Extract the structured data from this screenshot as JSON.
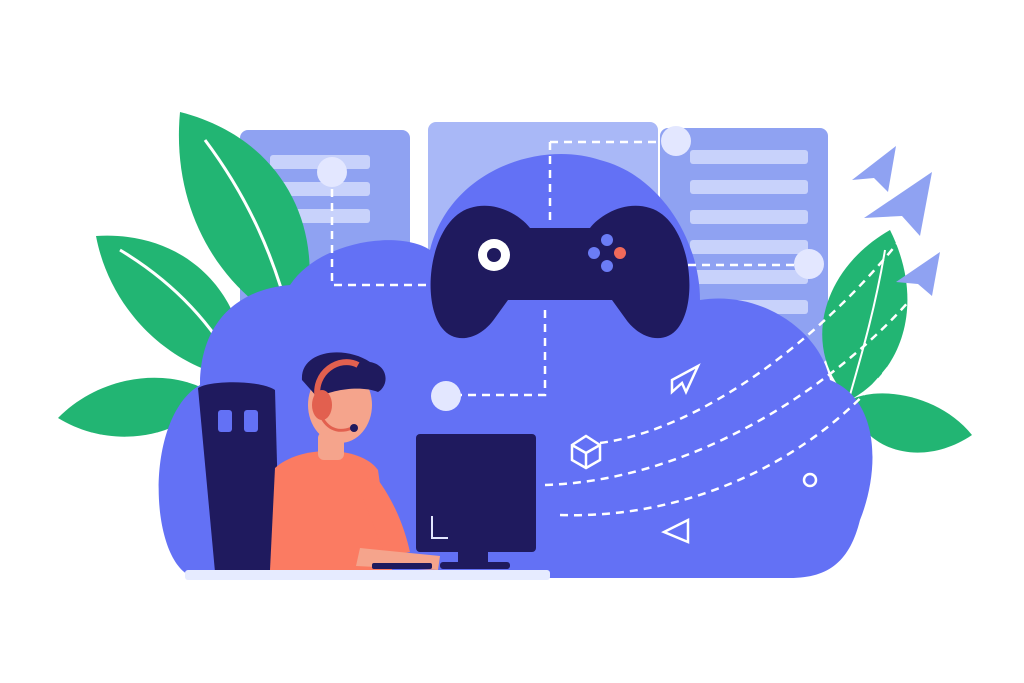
{
  "scene": {
    "subject": "cloud-gaming-illustration",
    "colors": {
      "background": "#ffffff",
      "cloud": "#6371f5",
      "cloud_outline": "#5a67ea",
      "server": "#8fa2f2",
      "server_light": "#a9b8f7",
      "server_row": "#c8d2fb",
      "leaf": "#22b573",
      "leaf_dark": "#1e9e63",
      "navy": "#1f1a5e",
      "skin": "#f5a48c",
      "shirt": "#fb7b62",
      "headset": "#e2604f",
      "hair": "#1f1a5e",
      "desk": "#e6ebff",
      "node": "#e3e7ff",
      "button_red": "#f0695a",
      "button_blue": "#6b7cf5",
      "plane": "#8fa2f2",
      "dash": "#ffffff"
    },
    "icons": [
      "game-controller-icon",
      "cursor-arrow-icon",
      "cube-icon",
      "play-triangle-icon",
      "paper-plane-icon",
      "logo-icon"
    ]
  }
}
